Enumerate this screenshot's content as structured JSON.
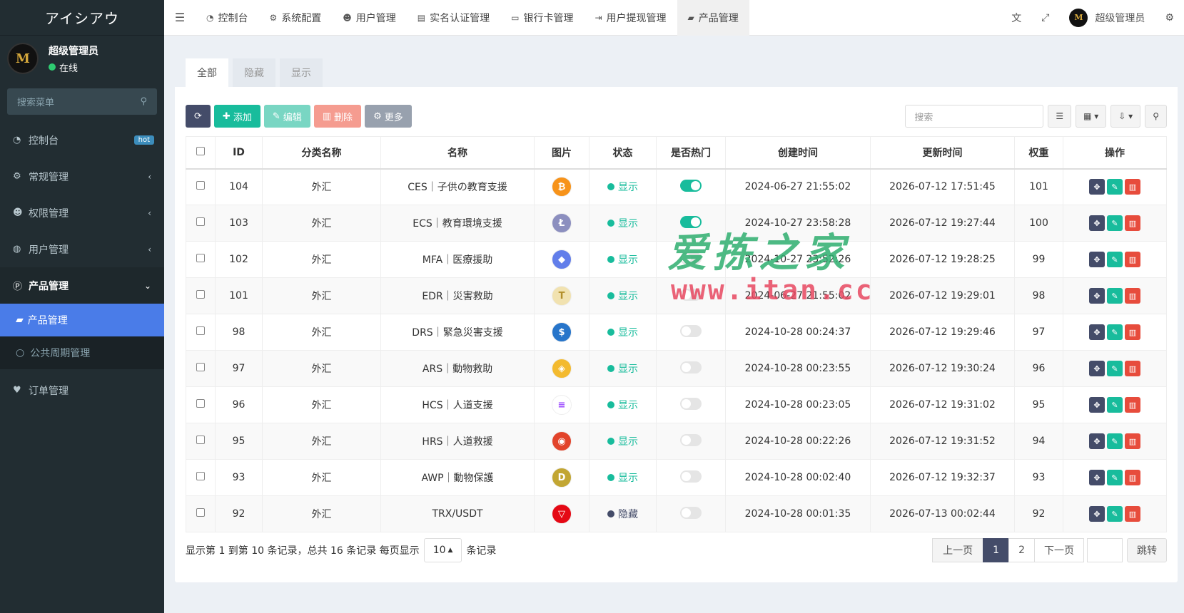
{
  "app": {
    "logo_text": "アイシアウ",
    "user_name": "超级管理员",
    "user_status": "在线",
    "status_color": "#2ecc71",
    "avatar_text": "M"
  },
  "sidebar": {
    "search_placeholder": "搜索菜单",
    "items": [
      {
        "label": "控制台",
        "icon": "dashboard-icon",
        "badge": "hot"
      },
      {
        "label": "常规管理",
        "icon": "cogs-icon"
      },
      {
        "label": "权限管理",
        "icon": "group-icon"
      },
      {
        "label": "用户管理",
        "icon": "user-circle-icon"
      },
      {
        "label": "产品管理",
        "icon": "product-icon"
      },
      {
        "label": "订单管理",
        "icon": "heartbeat-icon"
      }
    ],
    "sub_items": [
      {
        "label": "产品管理",
        "icon": "shopping-bag-icon"
      },
      {
        "label": "公共周期管理",
        "icon": "circle-icon"
      }
    ]
  },
  "topnav": {
    "items": [
      "控制台",
      "系统配置",
      "用户管理",
      "实名认证管理",
      "银行卡管理",
      "用户提现管理",
      "产品管理"
    ],
    "admin": "超级管理员"
  },
  "tabs": [
    "全部",
    "隐藏",
    "显示"
  ],
  "toolbar": {
    "add": "添加",
    "edit": "编辑",
    "delete": "删除",
    "more": "更多",
    "search_placeholder": "搜索"
  },
  "table": {
    "headers": [
      "ID",
      "分类名称",
      "名称",
      "图片",
      "状态",
      "是否热门",
      "创建时间",
      "更新时间",
      "权重",
      "操作"
    ],
    "rows": [
      {
        "id": "104",
        "cat": "外汇",
        "name": "CES｜子供の教育支援",
        "coin": "bitcoin-icon",
        "color": "#f7931a",
        "glyph": "₿",
        "status": "显示",
        "hot": true,
        "created": "2024-06-27 21:55:02",
        "updated": "2026-07-12 17:51:45",
        "weight": "101"
      },
      {
        "id": "103",
        "cat": "外汇",
        "name": "ECS｜教育環境支援",
        "coin": "litecoin-icon",
        "color": "#8c8fbf",
        "glyph": "Ł",
        "status": "显示",
        "hot": true,
        "created": "2024-10-27 23:58:28",
        "updated": "2026-07-12 19:27:44",
        "weight": "100"
      },
      {
        "id": "102",
        "cat": "外汇",
        "name": "MFA｜医療援助",
        "coin": "ethereum-icon",
        "color": "#627eea",
        "glyph": "◆",
        "status": "显示",
        "hot": false,
        "created": "2024-10-27 23:52:26",
        "updated": "2026-07-12 19:28:25",
        "weight": "99"
      },
      {
        "id": "101",
        "cat": "外汇",
        "name": "EDR｜災害救助",
        "coin": "tether-gold-icon",
        "color": "#f1e2b0",
        "glyph": "T",
        "status": "显示",
        "hot": false,
        "created": "2024-06-27 21:55:02",
        "updated": "2026-07-12 19:29:01",
        "weight": "98"
      },
      {
        "id": "98",
        "cat": "外汇",
        "name": "DRS｜緊急災害支援",
        "coin": "usdc-icon",
        "color": "#2775ca",
        "glyph": "$",
        "status": "显示",
        "hot": false,
        "created": "2024-10-28 00:24:37",
        "updated": "2026-07-12 19:29:46",
        "weight": "97"
      },
      {
        "id": "97",
        "cat": "外汇",
        "name": "ARS｜動物救助",
        "coin": "binance-icon",
        "color": "#f3ba2f",
        "glyph": "◈",
        "status": "显示",
        "hot": false,
        "created": "2024-10-28 00:23:55",
        "updated": "2026-07-12 19:30:24",
        "weight": "96"
      },
      {
        "id": "96",
        "cat": "外汇",
        "name": "HCS｜人道支援",
        "coin": "solana-icon",
        "color": "#ffffff",
        "glyph": "≡",
        "status": "显示",
        "hot": false,
        "created": "2024-10-28 00:23:05",
        "updated": "2026-07-12 19:31:02",
        "weight": "95"
      },
      {
        "id": "95",
        "cat": "外汇",
        "name": "HRS｜人道救援",
        "coin": "shiba-icon",
        "color": "#e2442b",
        "glyph": "◉",
        "status": "显示",
        "hot": false,
        "created": "2024-10-28 00:22:26",
        "updated": "2026-07-12 19:31:52",
        "weight": "94"
      },
      {
        "id": "93",
        "cat": "外汇",
        "name": "AWP｜動物保護",
        "coin": "dogecoin-icon",
        "color": "#c2a633",
        "glyph": "D",
        "status": "显示",
        "hot": false,
        "created": "2024-10-28 00:02:40",
        "updated": "2026-07-12 19:32:37",
        "weight": "93"
      },
      {
        "id": "92",
        "cat": "外汇",
        "name": "TRX/USDT",
        "coin": "tron-icon",
        "color": "#e50915",
        "glyph": "▽",
        "status": "隐藏",
        "hot": false,
        "created": "2024-10-28 00:01:35",
        "updated": "2026-07-13 00:02:44",
        "weight": "92"
      }
    ]
  },
  "footer": {
    "summary": "显示第 1 到第 10 条记录，总共 16 条记录 每页显示",
    "page_size": "10",
    "suffix": "条记录",
    "prev": "上一页",
    "page1": "1",
    "page2": "2",
    "next": "下一页",
    "jump": "跳转"
  },
  "watermark": {
    "line1": "爱拣之家",
    "line2": "www.itan.cc"
  },
  "colors": {
    "show": "#18bc9c",
    "hide": "#444c69",
    "active_menu": "#4a7ce8"
  }
}
